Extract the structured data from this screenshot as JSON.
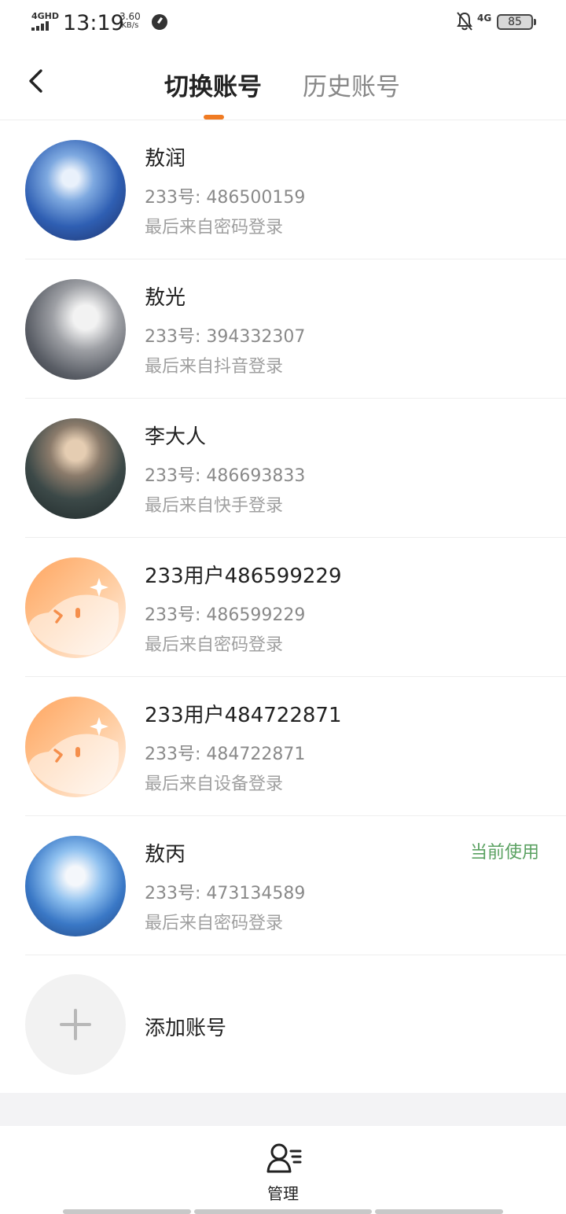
{
  "status_bar": {
    "network": "4GHD",
    "time": "13:19",
    "speed": "3.60",
    "speed_unit": "KB/s",
    "mobile": "4G",
    "battery": "85"
  },
  "nav": {
    "tabs": [
      {
        "label": "切换账号",
        "active": true
      },
      {
        "label": "历史账号",
        "active": false
      }
    ],
    "accent_color": "#f07b23"
  },
  "accounts": [
    {
      "name": "敖润",
      "uid": "233号: 486500159",
      "source": "最后来自密码登录",
      "avatar": "avatar-portrait"
    },
    {
      "name": "敖光",
      "uid": "233号: 394332307",
      "source": "最后来自抖音登录",
      "avatar": "avatar-portrait"
    },
    {
      "name": "李大人",
      "uid": "233号: 486693833",
      "source": "最后来自快手登录",
      "avatar": "avatar-portrait"
    },
    {
      "name": "233用户486599229",
      "uid": "233号: 486599229",
      "source": "最后来自密码登录",
      "avatar": "default-avatar"
    },
    {
      "name": "233用户484722871",
      "uid": "233号: 484722871",
      "source": "最后来自设备登录",
      "avatar": "default-avatar"
    },
    {
      "name": "敖丙",
      "uid": "233号: 473134589",
      "source": "最后来自密码登录",
      "avatar": "avatar-portrait",
      "badge": "当前使用"
    }
  ],
  "add_account": {
    "label": "添加账号",
    "icon": "plus-icon"
  },
  "bottom": {
    "manage_label": "管理",
    "icon": "manage-user-icon"
  },
  "colors": {
    "current_badge": "#5aa161",
    "default_avatar": "#ffa560"
  }
}
